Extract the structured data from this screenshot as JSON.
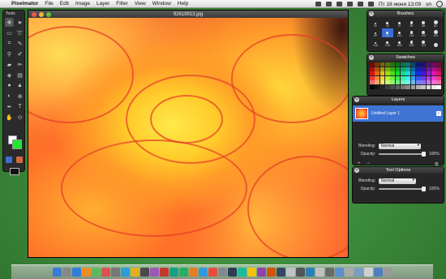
{
  "menubar": {
    "app_name": "Pixelmator",
    "items": [
      "File",
      "Edit",
      "Image",
      "Layer",
      "Filter",
      "View",
      "Window",
      "Help"
    ],
    "clock": "Пт 18 июня 13:09",
    "user": "sn"
  },
  "tools_panel": {
    "title": "Tools"
  },
  "document": {
    "title": "92619913.jpg"
  },
  "brushes": {
    "title": "Brushes",
    "sizes": [
      "32",
      "40",
      "47",
      "59",
      "68",
      "84",
      "90",
      "71",
      "110",
      "118",
      "120",
      "120",
      "148",
      "148",
      "495",
      "255",
      "104",
      ""
    ],
    "selected_index": 7
  },
  "swatches": {
    "title": "Swatches"
  },
  "layers": {
    "title": "Layers",
    "layer_name": "Untitled Layer 1",
    "blending_label": "Blending:",
    "blending_value": "Normal",
    "opacity_label": "Opacity:",
    "opacity_value": "100%",
    "footer_add": "+",
    "footer_remove": "−"
  },
  "tool_options": {
    "title": "Tool Options",
    "blending_label": "Blending:",
    "blending_value": "Normal",
    "opacity_label": "Opacity:",
    "opacity_value": "100%"
  },
  "colors": {
    "foreground": "#ffffff",
    "background": "#1fe82f",
    "selection": "#3a6fd8",
    "desktop": "#3b8a3a"
  }
}
